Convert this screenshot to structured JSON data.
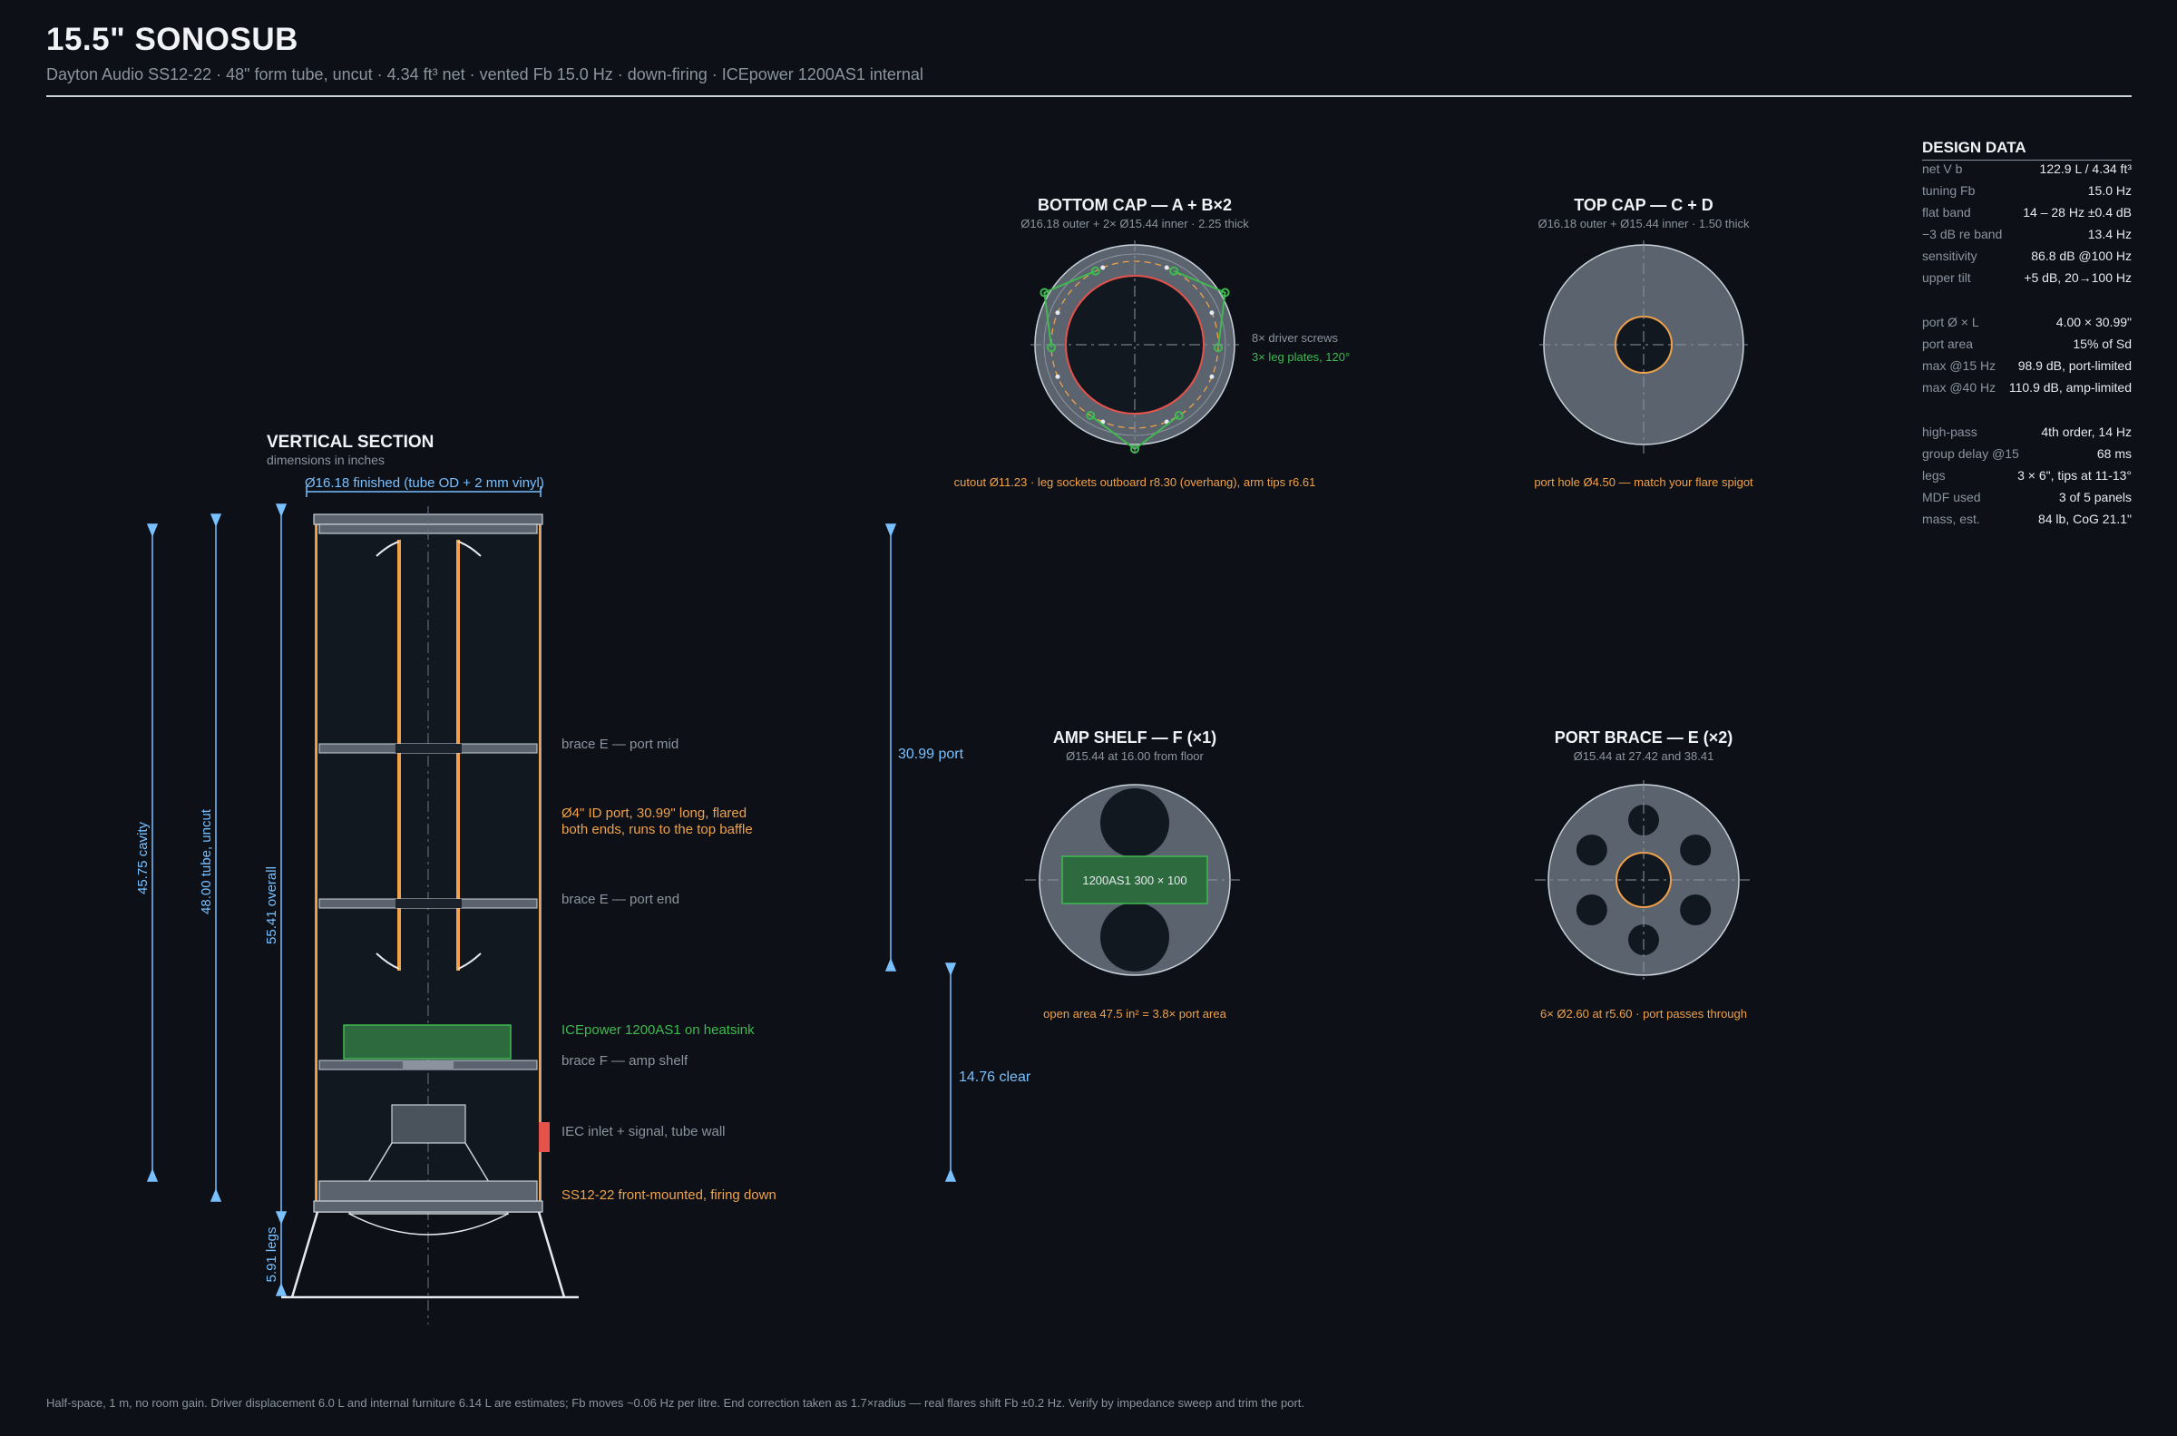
{
  "header": {
    "title": "15.5\" SONOSUB",
    "subtitle": "Dayton Audio SS12-22 · 48\" form tube, uncut · 4.34 ft³ net · vented Fb 15.0 Hz · down-firing · ICEpower 1200AS1 internal"
  },
  "section": {
    "title": "VERTICAL SECTION",
    "subtitle": "dimensions in inches",
    "diameter_label": "Ø16.18 finished (tube OD + 2 mm vinyl)",
    "dim_cavity": "45.75 cavity",
    "dim_tube": "48.00 tube, uncut",
    "dim_overall": "55.41 overall",
    "dim_legs": "5.91 legs",
    "dim_port": "30.99 port",
    "dim_clear": "14.76 clear",
    "label_brace_mid": "brace E — port mid",
    "label_port_1": "Ø4\" ID port, 30.99\" long, flared",
    "label_port_2": "both ends, runs to the top baffle",
    "label_brace_end": "brace E — port end",
    "label_amp": "ICEpower 1200AS1 on heatsink",
    "label_shelf": "brace F — amp shelf",
    "label_iec": "IEC inlet + signal, tube wall",
    "label_driver": "SS12-22 front-mounted, firing down"
  },
  "bottom_cap": {
    "title": "BOTTOM CAP — A + B×2",
    "subtitle": "Ø16.18 outer + 2× Ø15.44 inner · 2.25 thick",
    "note_screws": "8× driver screws",
    "note_legs": "3× leg plates, 120°",
    "caption": "cutout Ø11.23 · leg sockets outboard r8.30 (overhang), arm tips r6.61"
  },
  "top_cap": {
    "title": "TOP CAP — C + D",
    "subtitle": "Ø16.18 outer + Ø15.44 inner · 1.50 thick",
    "caption": "port hole Ø4.50 — match your flare spigot"
  },
  "amp_shelf": {
    "title": "AMP SHELF — F (×1)",
    "subtitle": "Ø15.44 at 16.00 from floor",
    "amp_label": "1200AS1 300 × 100",
    "caption": "open area 47.5 in² = 3.8× port area"
  },
  "port_brace": {
    "title": "PORT BRACE — E (×2)",
    "subtitle": "Ø15.44 at 27.42 and 38.41",
    "caption": "6× Ø2.60 at r5.60 · port passes through"
  },
  "design_data": {
    "title": "DESIGN DATA",
    "rows": [
      {
        "k": "net V b",
        "v": "122.9 L / 4.34 ft³"
      },
      {
        "k": "tuning Fb",
        "v": "15.0 Hz"
      },
      {
        "k": "flat band",
        "v": "14 – 28 Hz ±0.4 dB"
      },
      {
        "k": "−3 dB re band",
        "v": "13.4 Hz"
      },
      {
        "k": "sensitivity",
        "v": "86.8 dB @100 Hz"
      },
      {
        "k": "upper tilt",
        "v": "+5 dB, 20→100 Hz"
      },
      {
        "k": "port Ø × L",
        "v": "4.00 × 30.99\""
      },
      {
        "k": "port area",
        "v": "15% of Sd"
      },
      {
        "k": "max @15 Hz",
        "v": "98.9 dB, port-limited"
      },
      {
        "k": "max @40 Hz",
        "v": "110.9 dB, amp-limited"
      },
      {
        "k": "high-pass",
        "v": "4th order, 14 Hz"
      },
      {
        "k": "group delay @15",
        "v": "68 ms"
      },
      {
        "k": "legs",
        "v": "3 × 6\", tips at 11-13°"
      },
      {
        "k": "MDF used",
        "v": "3 of 5 panels"
      },
      {
        "k": "mass, est.",
        "v": "84 lb, CoG 21.1\""
      }
    ]
  },
  "footnote": "Half-space, 1 m, no room gain. Driver displacement 6.0 L and internal furniture 6.14 L are estimates; Fb moves ~0.06 Hz per litre. End correction taken as 1.7×radius — real flares shift Fb ±0.2 Hz. Verify by impedance sweep and trim the port.",
  "colors": {
    "background": "#0d1117",
    "dimension": "#79c0ff",
    "port": "#f0a14a",
    "amp": "#3fb950",
    "iec": "#e5534b",
    "panel": "#5a636e"
  }
}
